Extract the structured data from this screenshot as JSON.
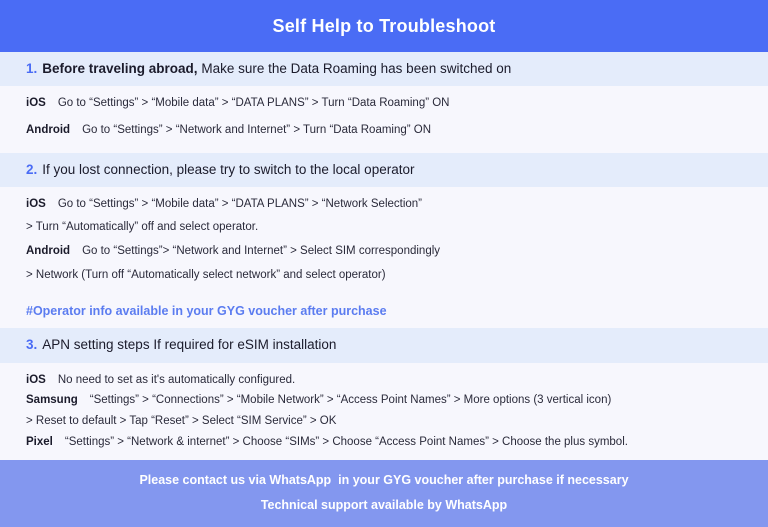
{
  "header": {
    "title": "Self Help to Troubleshoot",
    "bg_color": "#4a6cf5",
    "text_color": "#ffffff"
  },
  "theme": {
    "page_bg": "#f7f7fd",
    "band_bg": "#e4ecfb",
    "accent": "#4a6cf5",
    "accent_soft": "#5b7cf0",
    "footer_bg": "#8397ef",
    "body_text": "#2a2a3a",
    "heading_text": "#1b1b2b"
  },
  "sections": [
    {
      "number": "1.",
      "heading_lead": "Before traveling abroad,",
      "heading_rest": "Make sure the Data Roaming has been switched on",
      "rows": [
        {
          "os": "iOS",
          "text": "Go to “Settings” > “Mobile data” > “DATA PLANS” > Turn “Data Roaming” ON"
        },
        {
          "os": "Android",
          "text": "Go to “Settings” > “Network and Internet” > Turn “Data Roaming” ON"
        }
      ]
    },
    {
      "number": "2.",
      "heading_lead": "If you lost connection, please try to switch to the local operator",
      "heading_rest": "",
      "rows": [
        {
          "os": "iOS",
          "text": "Go to “Settings” > “Mobile data” > “DATA PLANS” > “Network Selection”"
        },
        {
          "os": "",
          "text": "> Turn “Automatically” off and select operator."
        },
        {
          "os": "Android",
          "text": "Go to “Settings”>  “Network and Internet” > Select SIM correspondingly"
        },
        {
          "os": "",
          "text": "> Network (Turn off “Automatically select network” and select operator)"
        }
      ],
      "note": "#Operator info available in your GYG voucher after purchase"
    },
    {
      "number": "3.",
      "heading_lead": "APN setting steps If required for eSIM installation",
      "heading_rest": "",
      "rows": [
        {
          "os": "iOS",
          "text": "No need to set as it's automatically configured."
        },
        {
          "os": "Samsung",
          "text": "“Settings” > “Connections” > “Mobile Network” > “Access Point Names” > More options (3 vertical icon)"
        },
        {
          "os": "",
          "text": "> Reset to default > Tap “Reset” > Select “SIM Service” > OK"
        },
        {
          "os": "Pixel",
          "text": "“Settings” > “Network & internet” > Choose “SIMs” > Choose “Access Point Names” > Choose the plus symbol."
        }
      ]
    }
  ],
  "footer": {
    "line1": "Please contact us via WhatsApp  in your GYG voucher after purchase if necessary",
    "line2": "Technical support available by WhatsApp"
  }
}
